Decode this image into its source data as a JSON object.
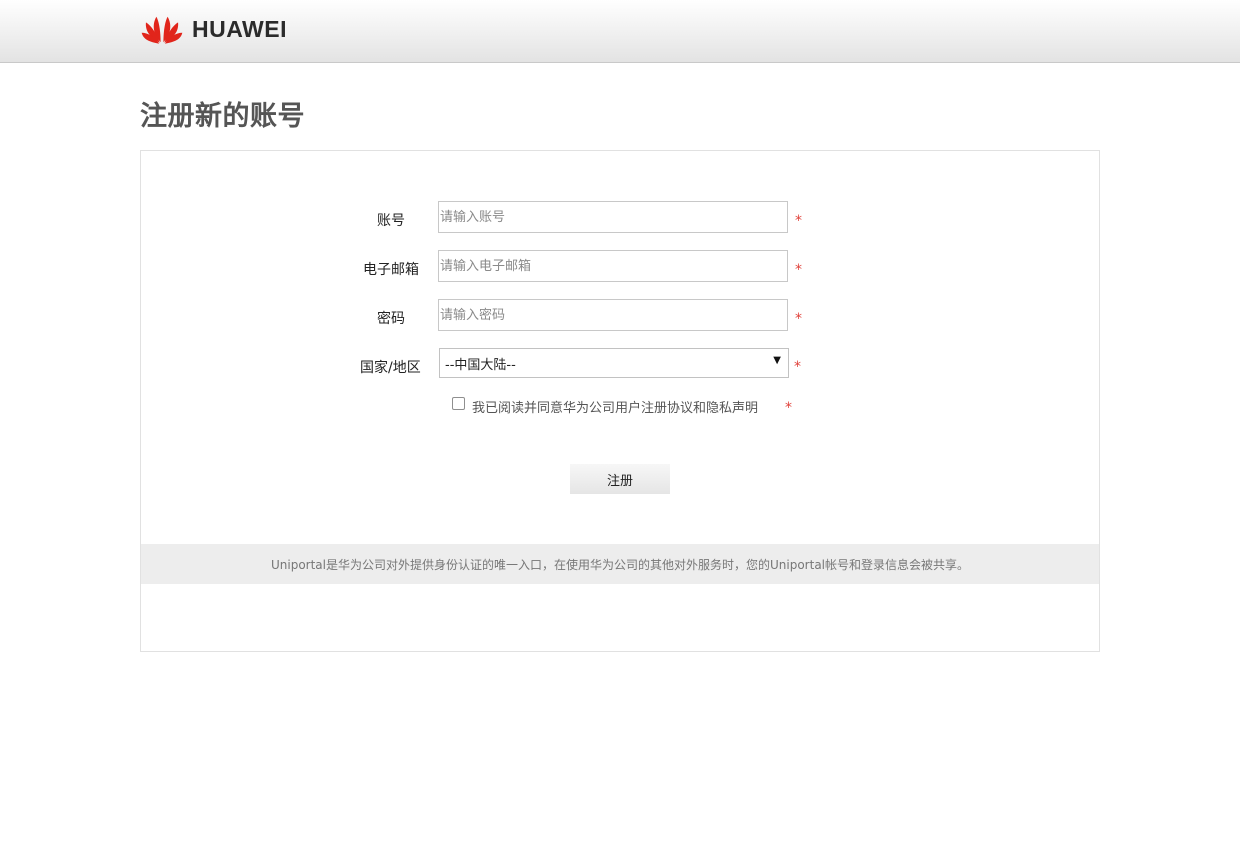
{
  "header": {
    "brand": "HUAWEI",
    "brand_color": "#e1251b"
  },
  "page": {
    "title": "注册新的账号"
  },
  "form": {
    "account_label": "账号",
    "account_placeholder": "请输入账号",
    "email_label": "电子邮箱",
    "email_placeholder": "请输入电子邮箱",
    "password_label": "密码",
    "password_placeholder": "请输入密码",
    "country_label": "国家/地区",
    "country_value": "--中国大陆--",
    "required_mark": "*",
    "agreement_text": "我已阅读并同意华为公司用户注册协议和隐私声明",
    "agreement_checked": false,
    "submit_label": "注册",
    "required_color": "#e0413a"
  },
  "notice": {
    "text": "Uniportal是华为公司对外提供身份认证的唯一入口，在使用华为公司的其他对外服务时，您的Uniportal帐号和登录信息会被共享。"
  }
}
